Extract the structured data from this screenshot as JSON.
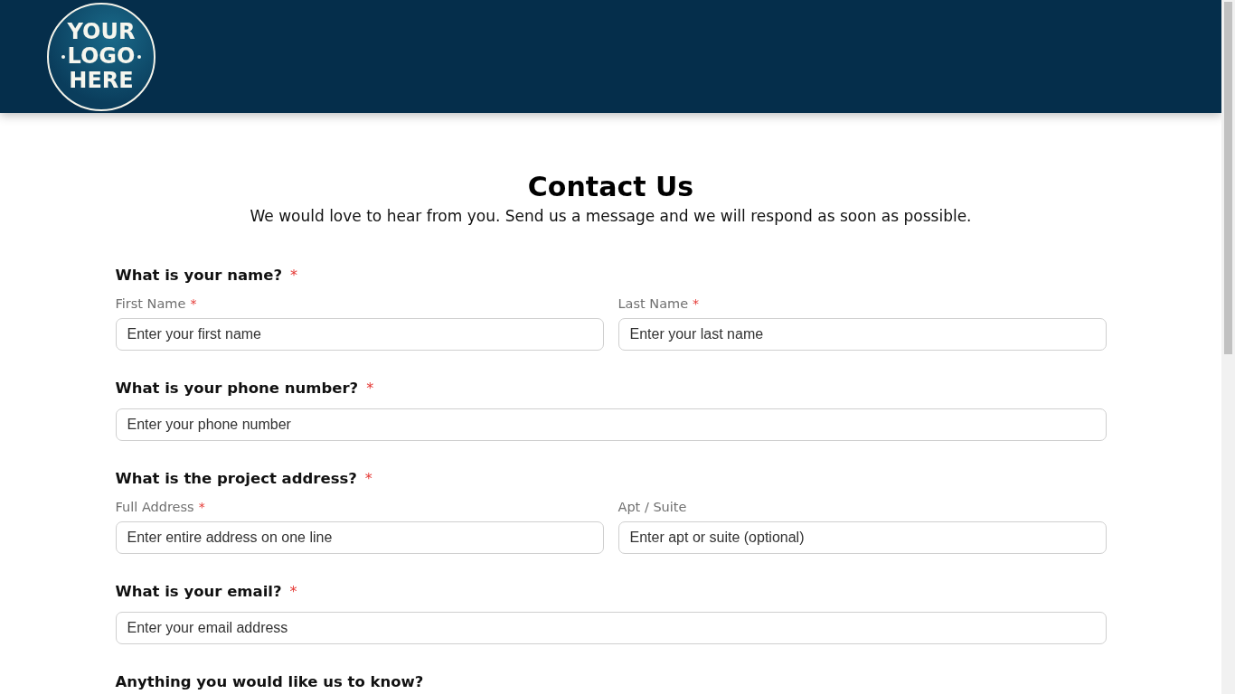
{
  "header": {
    "logo": {
      "lines": [
        "YOUR",
        "LOGO",
        "HERE"
      ]
    }
  },
  "title": "Contact Us",
  "subtitle": "We would love to hear from you. Send us a message and we will respond as soon as possible.",
  "questions": [
    {
      "title": "What is your name?",
      "mark": "*",
      "fields": [
        {
          "label": "First Name",
          "mark": "*",
          "placeholder": "Enter your first name"
        },
        {
          "label": "Last Name",
          "mark": "*",
          "placeholder": "Enter your last name"
        }
      ]
    },
    {
      "title": "What is your phone number?",
      "mark": "*",
      "fields": [
        {
          "placeholder": "Enter your phone number"
        }
      ]
    },
    {
      "title": "What is the project address?",
      "mark": "*",
      "fields": [
        {
          "label": "Full Address",
          "mark": "*",
          "placeholder": "Enter entire address on one line"
        },
        {
          "label": "Apt / Suite",
          "placeholder": "Enter apt or suite (optional)"
        }
      ]
    },
    {
      "title": "What is your email?",
      "mark": "*",
      "fields": [
        {
          "placeholder": "Enter your email address"
        }
      ]
    },
    {
      "title": "Anything you would like us to know?"
    }
  ]
}
